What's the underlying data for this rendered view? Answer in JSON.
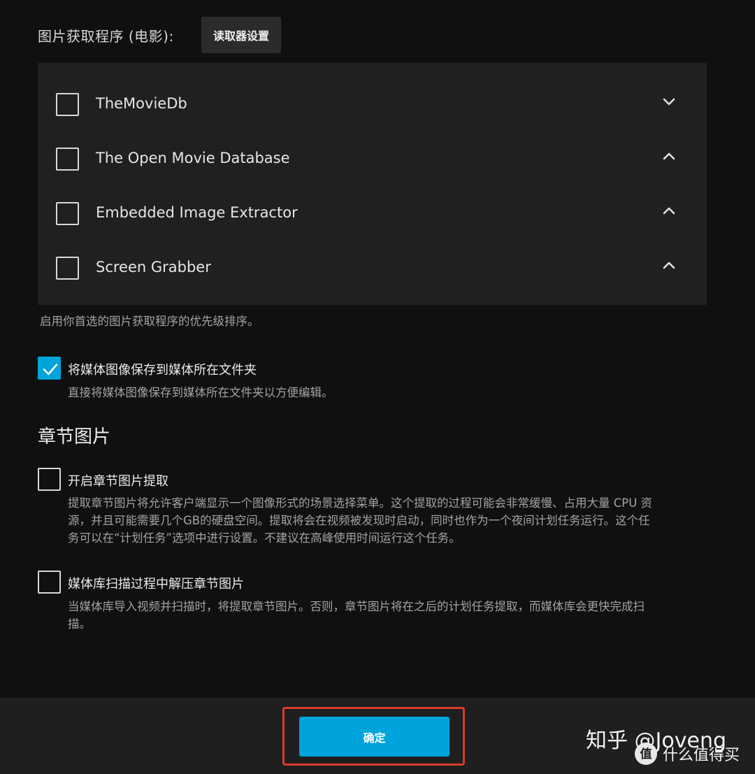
{
  "image_fetchers": {
    "label": "图片获取程序 (电影):",
    "settings_button": "读取器设置",
    "items": [
      {
        "name": "TheMovieDb",
        "checked": false,
        "chevron": "chevron-down-icon"
      },
      {
        "name": "The Open Movie Database",
        "checked": false,
        "chevron": "chevron-up-icon"
      },
      {
        "name": "Embedded Image Extractor",
        "checked": false,
        "chevron": "chevron-up-icon"
      },
      {
        "name": "Screen Grabber",
        "checked": false,
        "chevron": "chevron-up-icon"
      }
    ],
    "help": "启用你首选的图片获取程序的优先级排序。"
  },
  "save_local": {
    "label": "将媒体图像保存到媒体所在文件夹",
    "checked": true,
    "description": "直接将媒体图像保存到媒体所在文件夹以方便编辑。"
  },
  "chapter_section": {
    "title": "章节图片",
    "extract": {
      "label": "开启章节图片提取",
      "checked": false,
      "description_lines": [
        "提取章节图片将允许客户端显示一个图像形式的场景选择菜单。这个提取的过程可能会非常缓慢、占用大量 CPU 资",
        "源，并且可能需要几个GB的硬盘空间。提取将会在视频被发现时启动，同时也作为一个夜间计划任务运行。这个任",
        "务可以在“计划任务”选项中进行设置。不建议在高峰使用时间运行这个任务。"
      ]
    },
    "scan": {
      "label": "媒体库扫描过程中解压章节图片",
      "checked": false,
      "description_lines": [
        "当媒体库导入视频并扫描时，将提取章节图片。否则，章节图片将在之后的计划任务提取，而媒体库会更快完成扫",
        "描。"
      ]
    }
  },
  "footer": {
    "ok_button": "确定"
  },
  "watermark": {
    "text": "知乎 @Joveng",
    "sub": "什么值得买",
    "logo_char": "值"
  },
  "colors": {
    "accent": "#00a4dc",
    "highlight_border": "#d93a2b",
    "background": "#101010",
    "panel": "#202020"
  }
}
